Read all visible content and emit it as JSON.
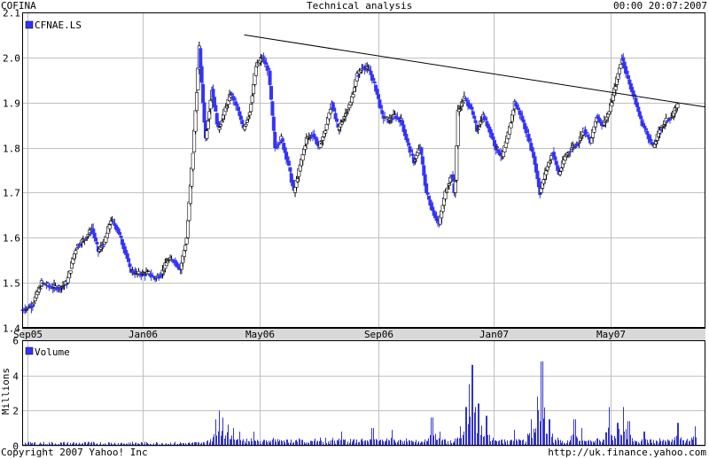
{
  "header": {
    "symbol": "COFINA",
    "title": "Technical analysis",
    "timestamp": "00:00 20:07:2007"
  },
  "footer": {
    "copyright": "Copyright 2007 Yahoo! Inc",
    "source": "http://uk.finance.yahoo.com"
  },
  "colors": {
    "up": "#ffffff",
    "down": "#3333ff",
    "outline": "#000000",
    "grid": "#c0c0c0",
    "axis_band": "#d9d9d9",
    "volume": "#3333cc"
  },
  "chart_data": [
    {
      "type": "candlestick",
      "legend": "CFNAE.LS",
      "legend_position": "top-left",
      "grid": true,
      "ylim": [
        1.4,
        2.1
      ],
      "yticks": [
        "1.4",
        "1.5",
        "1.6",
        "1.7",
        "1.8",
        "1.9",
        "2.0",
        "2.1"
      ],
      "x_range_weeks": [
        0,
        108.3
      ],
      "x_ticks": [
        {
          "label": "Sep05",
          "week": 0.9
        },
        {
          "label": "Jan06",
          "week": 19.1
        },
        {
          "label": "May06",
          "week": 37.6
        },
        {
          "label": "Sep06",
          "week": 56.5
        },
        {
          "label": "Jan07",
          "week": 74.7
        },
        {
          "label": "May07",
          "week": 93.2
        }
      ],
      "close_path": [
        [
          0,
          1.44
        ],
        [
          1.5,
          1.45
        ],
        [
          3,
          1.5
        ],
        [
          4.5,
          1.49
        ],
        [
          6,
          1.49
        ],
        [
          7,
          1.5
        ],
        [
          8.5,
          1.58
        ],
        [
          10,
          1.6
        ],
        [
          11,
          1.62
        ],
        [
          12,
          1.57
        ],
        [
          13,
          1.59
        ],
        [
          14,
          1.64
        ],
        [
          15,
          1.62
        ],
        [
          16,
          1.58
        ],
        [
          16.5,
          1.56
        ],
        [
          17,
          1.53
        ],
        [
          18,
          1.52
        ],
        [
          19,
          1.52
        ],
        [
          20,
          1.52
        ],
        [
          21,
          1.51
        ],
        [
          22,
          1.52
        ],
        [
          23,
          1.55
        ],
        [
          24,
          1.55
        ],
        [
          25,
          1.53
        ],
        [
          26,
          1.6
        ],
        [
          27,
          1.79
        ],
        [
          28,
          2.02
        ],
        [
          29,
          1.82
        ],
        [
          30,
          1.93
        ],
        [
          31,
          1.84
        ],
        [
          32,
          1.88
        ],
        [
          33,
          1.92
        ],
        [
          34,
          1.89
        ],
        [
          35,
          1.84
        ],
        [
          36,
          1.88
        ],
        [
          37,
          1.98
        ],
        [
          38,
          2.0
        ],
        [
          39,
          1.97
        ],
        [
          40,
          1.8
        ],
        [
          41,
          1.82
        ],
        [
          42,
          1.77
        ],
        [
          43,
          1.7
        ],
        [
          44,
          1.76
        ],
        [
          45,
          1.82
        ],
        [
          46,
          1.83
        ],
        [
          47,
          1.8
        ],
        [
          48,
          1.84
        ],
        [
          49,
          1.9
        ],
        [
          50,
          1.84
        ],
        [
          51,
          1.87
        ],
        [
          52,
          1.9
        ],
        [
          53,
          1.96
        ],
        [
          54,
          1.98
        ],
        [
          55,
          1.97
        ],
        [
          56,
          1.93
        ],
        [
          57,
          1.87
        ],
        [
          58,
          1.86
        ],
        [
          59,
          1.87
        ],
        [
          60,
          1.86
        ],
        [
          61,
          1.81
        ],
        [
          62,
          1.77
        ],
        [
          63,
          1.8
        ],
        [
          64,
          1.7
        ],
        [
          65,
          1.66
        ],
        [
          66,
          1.63
        ],
        [
          67,
          1.7
        ],
        [
          68,
          1.74
        ],
        [
          68.5,
          1.69
        ],
        [
          69,
          1.88
        ],
        [
          70,
          1.91
        ],
        [
          71,
          1.89
        ],
        [
          72,
          1.84
        ],
        [
          73,
          1.87
        ],
        [
          74,
          1.84
        ],
        [
          75,
          1.8
        ],
        [
          76,
          1.78
        ],
        [
          77,
          1.83
        ],
        [
          78,
          1.9
        ],
        [
          79,
          1.87
        ],
        [
          80,
          1.83
        ],
        [
          81,
          1.78
        ],
        [
          82,
          1.7
        ],
        [
          83,
          1.75
        ],
        [
          84,
          1.79
        ],
        [
          85,
          1.74
        ],
        [
          86,
          1.78
        ],
        [
          87,
          1.8
        ],
        [
          88,
          1.81
        ],
        [
          89,
          1.84
        ],
        [
          90,
          1.81
        ],
        [
          91,
          1.87
        ],
        [
          92,
          1.85
        ],
        [
          93,
          1.88
        ],
        [
          94,
          1.94
        ],
        [
          95,
          2.0
        ],
        [
          96,
          1.95
        ],
        [
          97,
          1.91
        ],
        [
          98,
          1.86
        ],
        [
          99,
          1.83
        ],
        [
          100,
          1.8
        ],
        [
          101,
          1.84
        ],
        [
          102,
          1.86
        ],
        [
          103,
          1.87
        ],
        [
          104,
          1.9
        ]
      ]
    },
    {
      "type": "trendline",
      "x": [
        35.2,
        108.3
      ],
      "y": [
        2.05,
        1.89
      ]
    },
    {
      "type": "bar",
      "legend": "Volume",
      "legend_position": "top-left",
      "ylabel": "Millions",
      "ylim": [
        0,
        6
      ],
      "yticks": [
        "0",
        "2",
        "4",
        "6"
      ],
      "grid": true,
      "spikes": [
        [
          30.6,
          1.5
        ],
        [
          31.2,
          2.0
        ],
        [
          31.8,
          1.6
        ],
        [
          32.6,
          1.2
        ],
        [
          33.4,
          1.0
        ],
        [
          34.4,
          0.8
        ],
        [
          36.6,
          0.8
        ],
        [
          50.6,
          0.8
        ],
        [
          55.5,
          1.0
        ],
        [
          58.6,
          0.9
        ],
        [
          64.9,
          1.6
        ],
        [
          66.2,
          0.8
        ],
        [
          69.4,
          1.1
        ],
        [
          70.3,
          2.2
        ],
        [
          70.8,
          3.5
        ],
        [
          71.3,
          4.6
        ],
        [
          72.3,
          2.4
        ],
        [
          73.5,
          1.7
        ],
        [
          78.0,
          0.9
        ],
        [
          80.6,
          1.5
        ],
        [
          81.6,
          2.8
        ],
        [
          82.3,
          4.8
        ],
        [
          83.5,
          1.5
        ],
        [
          87.5,
          1.5
        ],
        [
          88.6,
          1.0
        ],
        [
          93.0,
          2.2
        ],
        [
          94.3,
          1.3
        ],
        [
          95.2,
          2.2
        ],
        [
          96.1,
          1.4
        ],
        [
          98.5,
          0.8
        ],
        [
          103.9,
          1.3
        ],
        [
          106.6,
          1.1
        ]
      ]
    }
  ]
}
